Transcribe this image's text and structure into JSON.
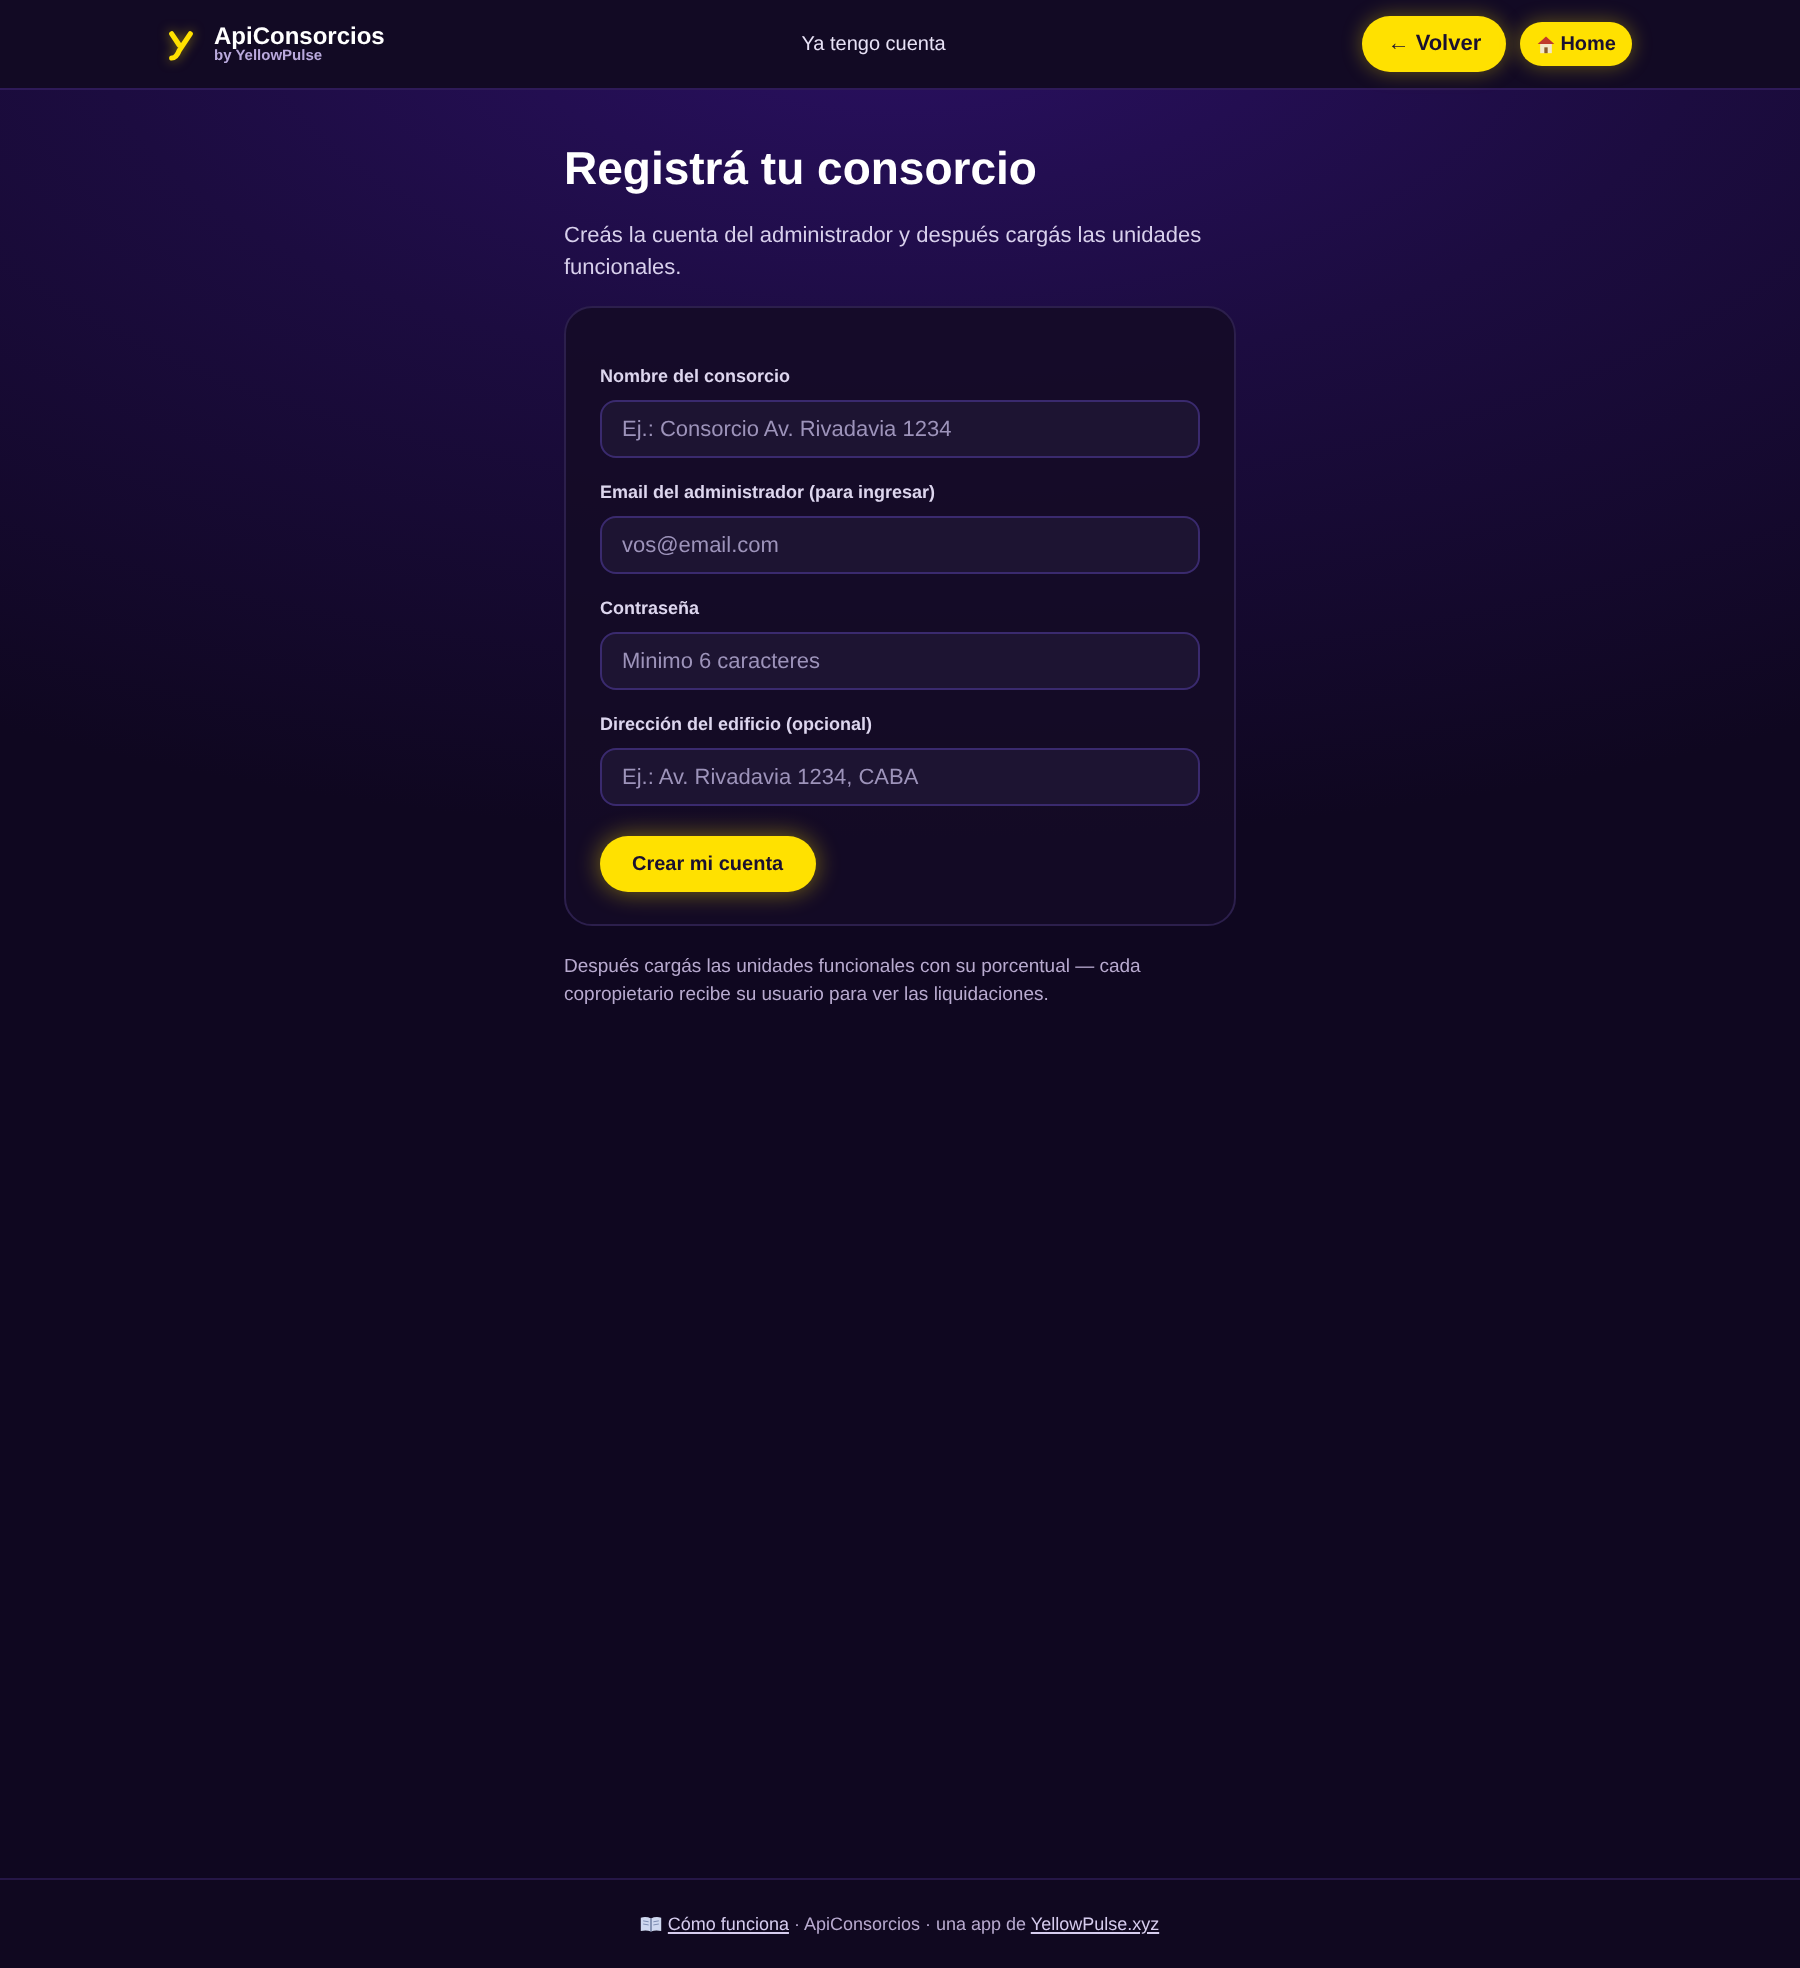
{
  "header": {
    "brand": {
      "name": "ApiConsorcios",
      "tagline": "by YellowPulse"
    },
    "nav_link": "Ya tengo cuenta",
    "buttons": [
      {
        "label": "← Volver",
        "kind": "back"
      },
      {
        "label": "Home",
        "kind": "home"
      }
    ]
  },
  "page": {
    "title": "Registrá tu consorcio",
    "subtitle": "Creás la cuenta del administrador y después cargás las unidades funcionales."
  },
  "form": {
    "fields": [
      {
        "label": "Nombre del consorcio",
        "placeholder": "Ej.: Consorcio Av. Rivadavia 1234"
      },
      {
        "label": "Email del administrador (para ingresar)",
        "placeholder": "vos@email.com"
      },
      {
        "label": "Contraseña",
        "placeholder": "Minimo 6 caracteres"
      },
      {
        "label": "Dirección del edificio (opcional)",
        "placeholder": "Ej.: Av. Rivadavia 1234, CABA"
      }
    ],
    "submit": "Crear mi cuenta"
  },
  "note": "Después cargás las unidades funcionales con su porcentual — cada copropietario recibe su usuario para ver las liquidaciones.",
  "footer": {
    "guide_link": "Cómo funciona",
    "text": "· ApiConsorcios · una app de",
    "site_link": "YellowPulse.xyz"
  }
}
